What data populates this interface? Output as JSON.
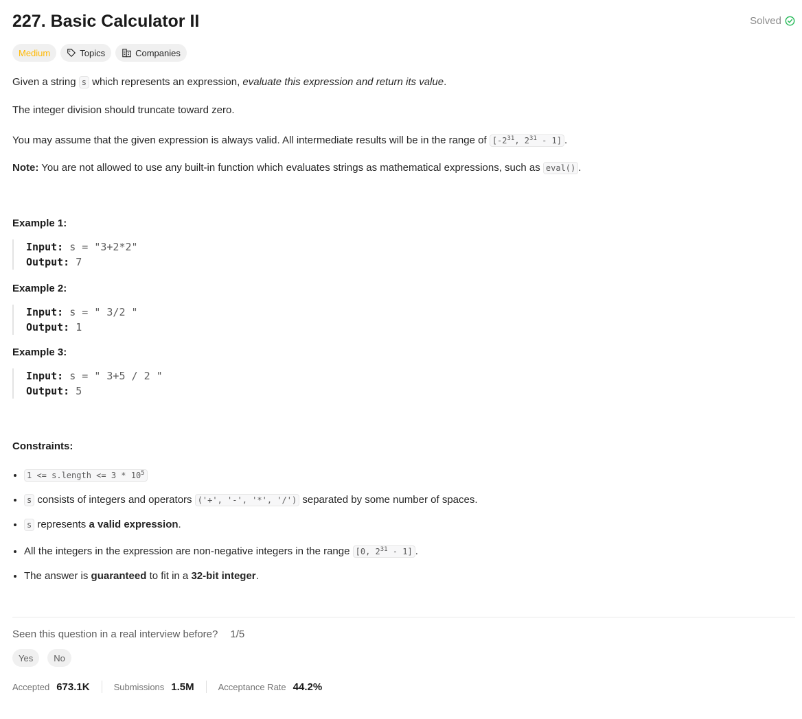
{
  "problem": {
    "title": "227. Basic Calculator II",
    "status": "Solved",
    "difficulty": "Medium",
    "tags": [
      "Topics",
      "Companies"
    ]
  },
  "description": {
    "p1": {
      "before": "Given a string ",
      "code": "s",
      "middle": " which represents an expression, ",
      "italic": "evaluate this expression and return its value",
      "after": "."
    },
    "p2": "The integer division should truncate toward zero.",
    "p3": {
      "text": "You may assume that the given expression is always valid. All intermediate results will be in the range of ",
      "range_open": "[-2",
      "exp1": "31",
      "range_mid": ", 2",
      "exp2": "31",
      "range_close": " - 1]",
      "after": "."
    },
    "p4": {
      "label": "Note:",
      "text": " You are not allowed to use any built-in function which evaluates strings as mathematical expressions, such as ",
      "code": "eval()",
      "after": "."
    }
  },
  "examples": [
    {
      "title": "Example 1:",
      "input_label": "Input:",
      "input": " s = \"3+2*2\"",
      "output_label": "Output:",
      "output": " 7"
    },
    {
      "title": "Example 2:",
      "input_label": "Input:",
      "input": " s = \" 3/2 \"",
      "output_label": "Output:",
      "output": " 1"
    },
    {
      "title": "Example 3:",
      "input_label": "Input:",
      "input": " s = \" 3+5 / 2 \"",
      "output_label": "Output:",
      "output": " 5"
    }
  ],
  "constraints": {
    "title": "Constraints:",
    "c1": {
      "code": "1 <= s.length <= 3 * 10",
      "exp": "5"
    },
    "c2": {
      "code": "s",
      "text": " consists of integers and operators ",
      "ops": "('+', '-', '*', '/')",
      "after": " separated by some number of spaces."
    },
    "c3": {
      "code": "s",
      "text": " represents ",
      "bold": "a valid expression",
      "after": "."
    },
    "c4": {
      "text": "All the integers in the expression are non-negative integers in the range ",
      "range_open": "[0, 2",
      "exp": "31",
      "range_close": " - 1]",
      "after": "."
    },
    "c5": {
      "text1": "The answer is ",
      "bold1": "guaranteed",
      "text2": " to fit in a ",
      "bold2": "32-bit integer",
      "after": "."
    }
  },
  "interview": {
    "question": "Seen this question in a real interview before?",
    "count": "1/5",
    "yes": "Yes",
    "no": "No"
  },
  "stats": {
    "accepted_label": "Accepted",
    "accepted_value": "673.1K",
    "submissions_label": "Submissions",
    "submissions_value": "1.5M",
    "acceptance_label": "Acceptance Rate",
    "acceptance_value": "44.2%"
  },
  "colors": {
    "medium": "#ffb800",
    "solved_check": "#2cbb5d"
  }
}
